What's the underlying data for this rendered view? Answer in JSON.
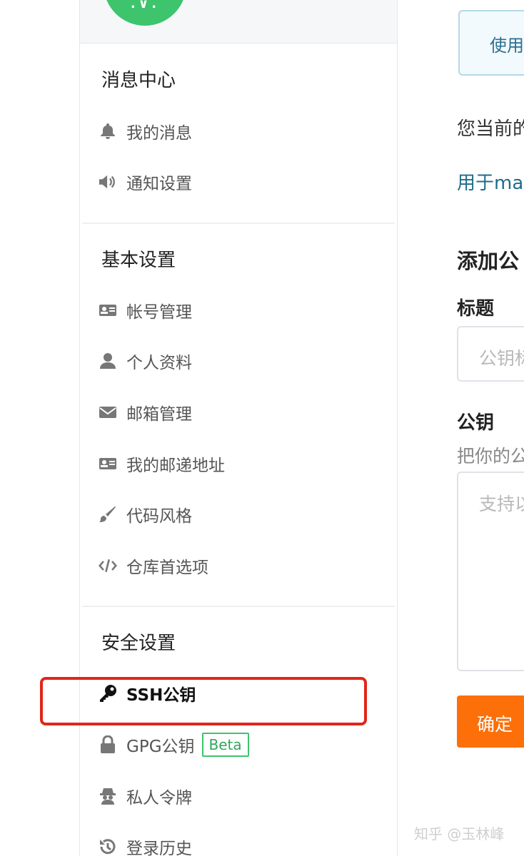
{
  "sidebar": {
    "sections": [
      {
        "title": "消息中心",
        "items": [
          {
            "label": "我的消息",
            "icon": "bell-icon"
          },
          {
            "label": "通知设置",
            "icon": "speaker-icon"
          }
        ]
      },
      {
        "title": "基本设置",
        "items": [
          {
            "label": "帐号管理",
            "icon": "id-card-icon"
          },
          {
            "label": "个人资料",
            "icon": "user-icon"
          },
          {
            "label": "邮箱管理",
            "icon": "envelope-icon"
          },
          {
            "label": "我的邮递地址",
            "icon": "id-card-icon"
          },
          {
            "label": "代码风格",
            "icon": "paint-brush-icon"
          },
          {
            "label": "仓库首选项",
            "icon": "code-icon"
          }
        ]
      },
      {
        "title": "安全设置",
        "items": [
          {
            "label": "SSH公钥",
            "icon": "key-icon",
            "active": true
          },
          {
            "label": "GPG公钥",
            "icon": "lock-icon",
            "badge": "Beta"
          },
          {
            "label": "私人令牌",
            "icon": "spy-icon"
          },
          {
            "label": "登录历史",
            "icon": "history-icon"
          }
        ]
      }
    ]
  },
  "main": {
    "top_button": "使用",
    "current_text": "您当前的",
    "link_text": "用于ma",
    "add_heading": "添加公",
    "title_label": "标题",
    "title_placeholder": "公钥标",
    "key_label": "公钥",
    "key_hint": "把你的公",
    "key_placeholder": "支持以",
    "confirm_button": "确定"
  },
  "watermark": "知乎 @玉林峰",
  "colors": {
    "accent_green": "#3ec46d",
    "confirm_orange": "#fc6f09",
    "highlight_red": "#e22518",
    "link_teal": "#1f6d8a"
  }
}
